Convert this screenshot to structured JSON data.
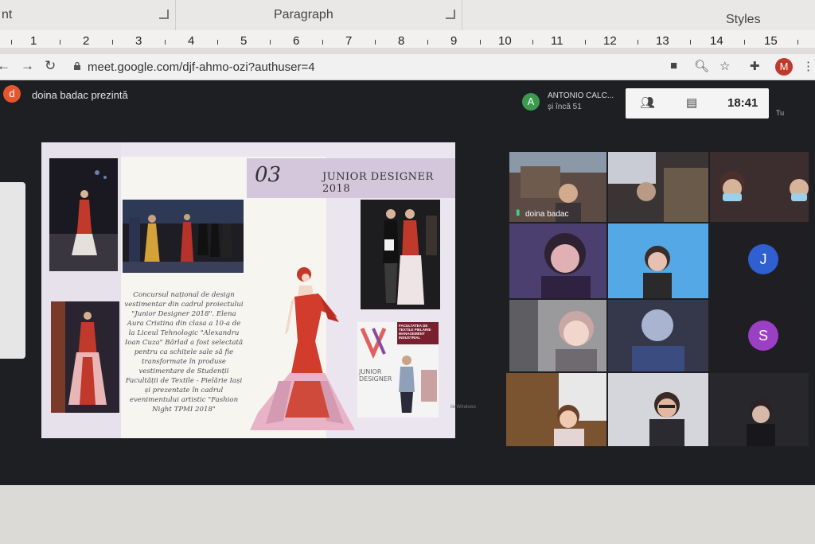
{
  "ribbon": {
    "groups": [
      {
        "label": "nt"
      },
      {
        "label": "Paragraph"
      },
      {
        "label": "Styles"
      }
    ]
  },
  "ruler": {
    "numbers": [
      "1",
      "2",
      "3",
      "4",
      "5",
      "6",
      "7",
      "8",
      "9",
      "10",
      "11",
      "12",
      "13",
      "14",
      "15"
    ]
  },
  "browser": {
    "url": "meet.google.com/djf-ahmo-ozi?authuser=4",
    "profile_letter": "M"
  },
  "meet": {
    "presenter_initial": "d",
    "presenter_text": "doina badac prezintă",
    "speaker_initial": "A",
    "speaker_name": "ANTONIO CALC...",
    "speaker_sub": "și încă 51",
    "clock": "18:41",
    "self_label": "Tu"
  },
  "slide": {
    "number": "03",
    "title": "JUNIOR DESIGNER 2018",
    "body": "Concursul național de design vestimentar din cadrul proiectului \"Junior Designer 2018\". Elena Aura Cristina din clasa a 10-a de la Liceul Tehnologic \"Alexandru Ioan Cuza\" Bârlad a fost selectată pentru ca schițele sale să fie transformate în produse vestimentare de Studenții Facultății de Textile - Pielărie Iași și prezentate în cadrul evenimentului artistic \"Fashion Night TPMI 2018\"",
    "poster_logo": "JUNIOR DESIGNER",
    "poster_banner": "FACULTATEA DE TEXTILE PIELĂRIE MANAGEMENT INDUSTRIAL",
    "watermark": "ile Windows"
  },
  "tiles": [
    {
      "name": "doina badac"
    },
    {
      "initial": "J",
      "color": "#2f5fd0"
    },
    {
      "initial": "S",
      "color": "#9b3fc4"
    }
  ]
}
